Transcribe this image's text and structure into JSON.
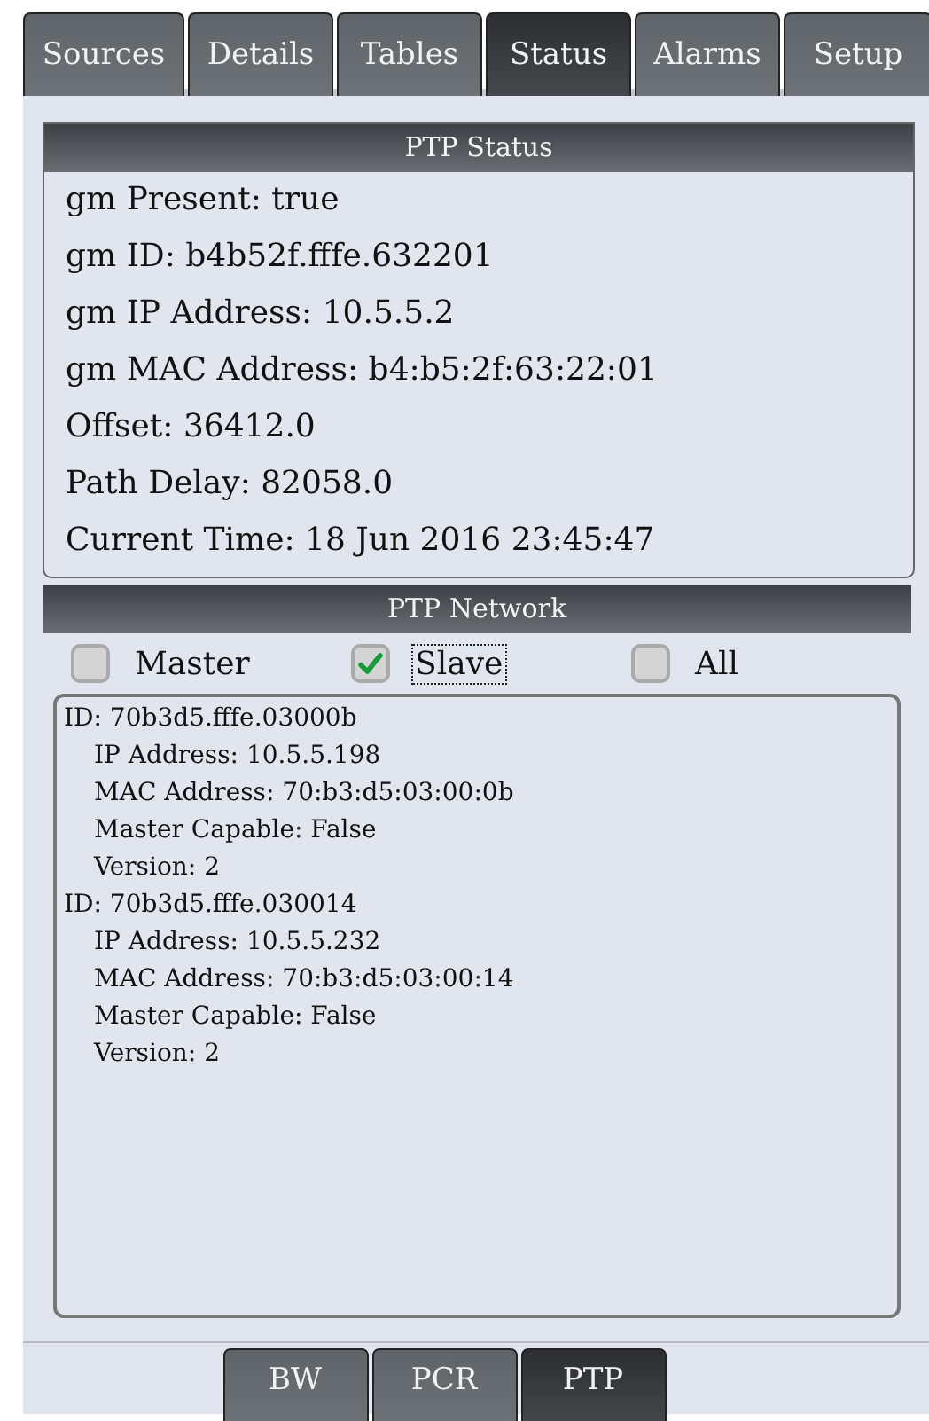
{
  "tabs": [
    {
      "label": "Sources",
      "selected": false
    },
    {
      "label": "Details",
      "selected": false
    },
    {
      "label": "Tables",
      "selected": false
    },
    {
      "label": "Status",
      "selected": true
    },
    {
      "label": "Alarms",
      "selected": false
    },
    {
      "label": "Setup",
      "selected": false
    }
  ],
  "ptp_status": {
    "title": "PTP Status",
    "lines": [
      "gm Present: true",
      "gm ID: b4b52f.fffe.632201",
      "gm IP Address: 10.5.5.2",
      "gm MAC Address: b4:b5:2f:63:22:01",
      "Offset: 36412.0",
      "Path Delay: 82058.0",
      "Current Time: 18 Jun 2016 23:45:47"
    ]
  },
  "ptp_network": {
    "title": "PTP Network",
    "filters": [
      {
        "label": "Master",
        "checked": false,
        "focused": false
      },
      {
        "label": "Slave",
        "checked": true,
        "focused": true
      },
      {
        "label": "All",
        "checked": false,
        "focused": false
      }
    ],
    "nodes": [
      {
        "text": "ID: 70b3d5.fffe.03000b",
        "children": [
          {
            "text": "IP Address: 10.5.5.198"
          },
          {
            "text": "MAC Address: 70:b3:d5:03:00:0b"
          },
          {
            "text": "Master Capable: False"
          },
          {
            "text": "Version: 2"
          }
        ]
      },
      {
        "text": "ID: 70b3d5.fffe.030014",
        "children": [
          {
            "text": "IP Address: 10.5.5.232"
          },
          {
            "text": "MAC Address: 70:b3:d5:03:00:14"
          },
          {
            "text": "Master Capable: False"
          },
          {
            "text": "Version: 2"
          }
        ]
      }
    ]
  },
  "bottom_tabs": [
    {
      "label": "BW",
      "selected": false
    },
    {
      "label": "PCR",
      "selected": false
    },
    {
      "label": "PTP",
      "selected": true
    }
  ]
}
